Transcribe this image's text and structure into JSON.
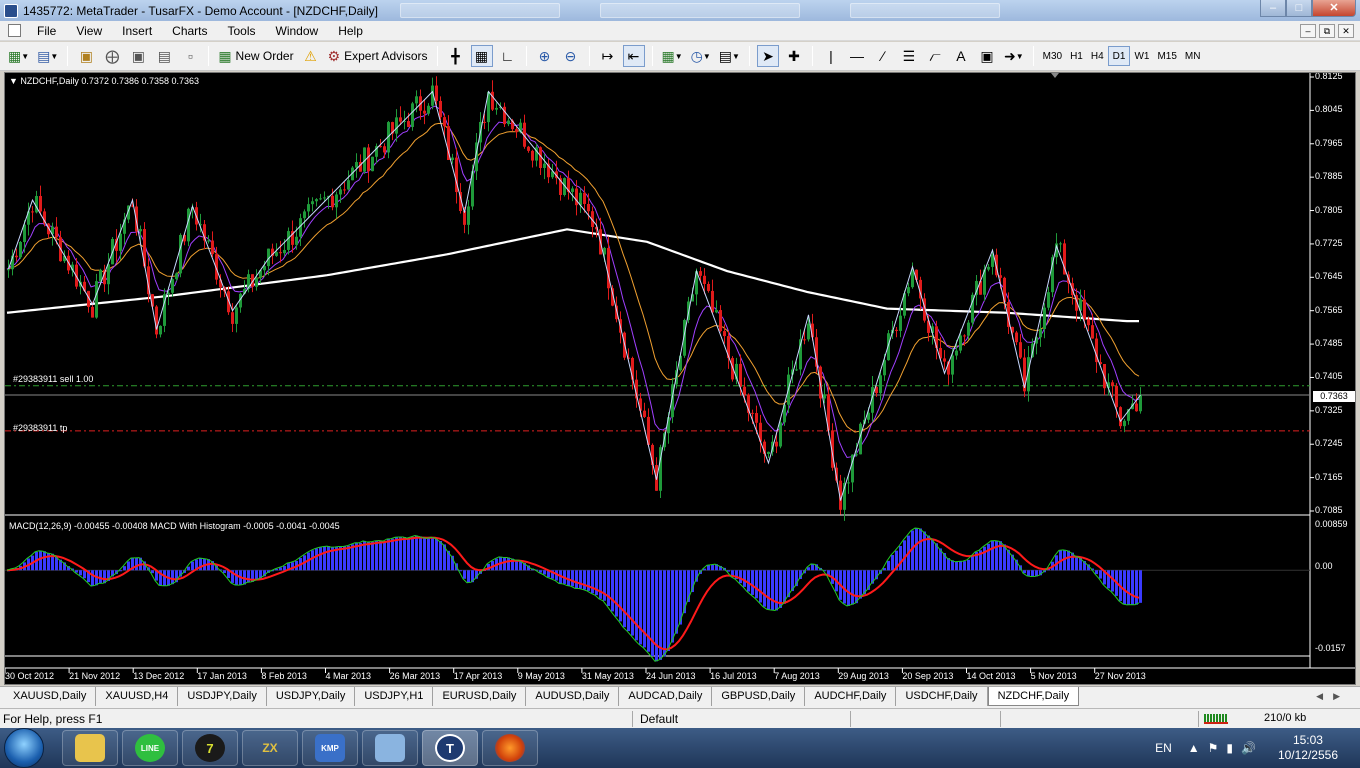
{
  "window": {
    "title": "1435772: MetaTrader - TusarFX - Demo Account - [NZDCHF,Daily]"
  },
  "menu": [
    "File",
    "View",
    "Insert",
    "Charts",
    "Tools",
    "Window",
    "Help"
  ],
  "toolbar": {
    "new_order": "New Order",
    "expert_advisors": "Expert Advisors",
    "timeframes": [
      "M30",
      "H1",
      "H4",
      "D1",
      "W1",
      "M15",
      "MN"
    ],
    "active_timeframe": "D1"
  },
  "chart": {
    "info": "NZDCHF,Daily  0.7372 0.7386 0.7358 0.7363",
    "current_price": "0.7363",
    "sell_order_label": "#29383911 sell 1.00",
    "tp_label": "#29383911 tp",
    "macd_info": "MACD(12,26,9) -0.00455 -0.00408  MACD With Histogram -0.0005 -0.0041 -0.0045",
    "macd_axis": [
      "0.00859",
      "0.00",
      "-0.0157"
    ],
    "colors": {
      "background": "#000000",
      "bull_candle": "#1f9a3a",
      "bear_candle": "#e01b1b",
      "sma_long": "#ffffff",
      "ma_fast": "#a040ff",
      "ma_slow": "#f0a030",
      "zigzag": "#c8d8ff",
      "sell_line": "#2f9e2f",
      "tp_line": "#e02020",
      "macd_hist": "#3a3aff",
      "macd_line": "#ff1a1a",
      "signal_line": "#22cc22"
    }
  },
  "chart_data": {
    "type": "candlestick",
    "title": "NZDCHF,Daily",
    "y_ticks": [
      "0.8125",
      "0.8045",
      "0.7965",
      "0.7885",
      "0.7805",
      "0.7725",
      "0.7645",
      "0.7565",
      "0.7485",
      "0.7405",
      "0.7325",
      "0.7245",
      "0.7165",
      "0.7085"
    ],
    "ylim": [
      0.7085,
      0.8125
    ],
    "x_ticks": [
      "30 Oct 2012",
      "21 Nov 2012",
      "13 Dec 2012",
      "17 Jan 2013",
      "8 Feb 2013",
      "4 Mar 2013",
      "26 Mar 2013",
      "17 Apr 2013",
      "9 May 2013",
      "31 May 2013",
      "24 Jun 2013",
      "16 Jul 2013",
      "7 Aug 2013",
      "29 Aug 2013",
      "20 Sep 2013",
      "14 Oct 2013",
      "5 Nov 2013",
      "27 Nov 2013"
    ],
    "last_ohlc": {
      "open": 0.7372,
      "high": 0.7386,
      "low": 0.7358,
      "close": 0.7363
    },
    "sell_level": 0.7385,
    "tp_level": 0.7277,
    "swing_points": [
      {
        "x": 0,
        "y": 0.7665
      },
      {
        "x": 6,
        "y": 0.783
      },
      {
        "x": 21,
        "y": 0.758
      },
      {
        "x": 31,
        "y": 0.783
      },
      {
        "x": 37,
        "y": 0.752
      },
      {
        "x": 46,
        "y": 0.7815
      },
      {
        "x": 56,
        "y": 0.7565
      },
      {
        "x": 65,
        "y": 0.769
      },
      {
        "x": 106,
        "y": 0.809
      },
      {
        "x": 114,
        "y": 0.78
      },
      {
        "x": 120,
        "y": 0.809
      },
      {
        "x": 147,
        "y": 0.777
      },
      {
        "x": 162,
        "y": 0.716
      },
      {
        "x": 172,
        "y": 0.766
      },
      {
        "x": 190,
        "y": 0.72
      },
      {
        "x": 200,
        "y": 0.7555
      },
      {
        "x": 208,
        "y": 0.711
      },
      {
        "x": 226,
        "y": 0.767
      },
      {
        "x": 234,
        "y": 0.7415
      },
      {
        "x": 246,
        "y": 0.771
      },
      {
        "x": 254,
        "y": 0.738
      },
      {
        "x": 262,
        "y": 0.772
      },
      {
        "x": 278,
        "y": 0.73
      },
      {
        "x": 283,
        "y": 0.7363
      }
    ],
    "sma_long_points": [
      {
        "x": 0,
        "y": 0.756
      },
      {
        "x": 40,
        "y": 0.76
      },
      {
        "x": 80,
        "y": 0.765
      },
      {
        "x": 110,
        "y": 0.77
      },
      {
        "x": 140,
        "y": 0.776
      },
      {
        "x": 160,
        "y": 0.773
      },
      {
        "x": 180,
        "y": 0.766
      },
      {
        "x": 200,
        "y": 0.761
      },
      {
        "x": 220,
        "y": 0.757
      },
      {
        "x": 250,
        "y": 0.756
      },
      {
        "x": 280,
        "y": 0.754
      }
    ],
    "macd_ylim": [
      -0.0157,
      0.00859
    ]
  },
  "tabs": [
    "XAUUSD,Daily",
    "XAUUSD,H4",
    "USDJPY,Daily",
    "USDJPY,Daily",
    "USDJPY,H1",
    "EURUSD,Daily",
    "AUDUSD,Daily",
    "AUDCAD,Daily",
    "GBPUSD,Daily",
    "AUDCHF,Daily",
    "USDCHF,Daily",
    "NZDCHF,Daily"
  ],
  "active_tab": "NZDCHF,Daily",
  "status": {
    "help": "For Help, press F1",
    "profile": "Default",
    "connection": "210/0 kb"
  },
  "taskbar": {
    "lang": "EN",
    "time": "15:03",
    "date": "10/12/2556"
  }
}
